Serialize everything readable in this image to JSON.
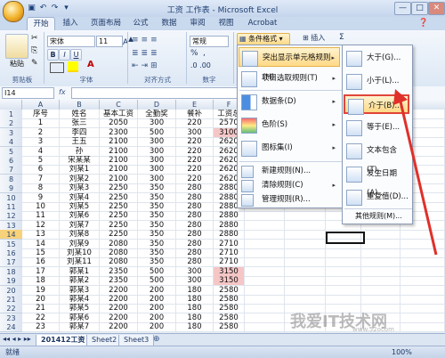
{
  "window": {
    "title": "工资 工作表 - Microsoft Excel",
    "controls": [
      "—",
      "□",
      "✕"
    ]
  },
  "tabs": [
    "开始",
    "插入",
    "页面布局",
    "公式",
    "数据",
    "审阅",
    "视图",
    "Acrobat"
  ],
  "ribbon": {
    "font_name": "宋体",
    "font_size": "11",
    "number_format": "常规",
    "cond_format_label": "条件格式",
    "insert_label": "插入",
    "sigma_label": "Σ",
    "groups": [
      "剪贴板",
      "字体",
      "对齐方式",
      "数字"
    ],
    "paste_label": "粘贴",
    "bold": "B",
    "italic": "I",
    "underline": "U",
    "percent": "%"
  },
  "formula_bar": {
    "name_box": "I14",
    "fx": "fx"
  },
  "columns": [
    "A",
    "B",
    "C",
    "D",
    "E",
    "F"
  ],
  "rows": [
    {
      "n": "1",
      "c": [
        "序号",
        "姓名",
        "基本工资",
        "全勤奖",
        "餐补",
        "工资总"
      ]
    },
    {
      "n": "2",
      "c": [
        "1",
        "张三",
        "2050",
        "300",
        "220",
        "2570"
      ]
    },
    {
      "n": "3",
      "c": [
        "2",
        "李四",
        "2300",
        "500",
        "300",
        "3100"
      ]
    },
    {
      "n": "4",
      "c": [
        "3",
        "王五",
        "2100",
        "300",
        "220",
        "2620"
      ]
    },
    {
      "n": "5",
      "c": [
        "4",
        "孙",
        "2100",
        "300",
        "220",
        "2620"
      ]
    },
    {
      "n": "6",
      "c": [
        "5",
        "宋某某",
        "2100",
        "300",
        "220",
        "2620"
      ]
    },
    {
      "n": "7",
      "c": [
        "6",
        "刘某1",
        "2100",
        "300",
        "220",
        "2620"
      ]
    },
    {
      "n": "8",
      "c": [
        "7",
        "刘某2",
        "2100",
        "300",
        "220",
        "2620"
      ]
    },
    {
      "n": "9",
      "c": [
        "8",
        "刘某3",
        "2250",
        "350",
        "280",
        "2880"
      ]
    },
    {
      "n": "10",
      "c": [
        "9",
        "刘某4",
        "2250",
        "350",
        "280",
        "2880"
      ]
    },
    {
      "n": "11",
      "c": [
        "10",
        "刘某5",
        "2250",
        "350",
        "280",
        "2880"
      ]
    },
    {
      "n": "12",
      "c": [
        "11",
        "刘某6",
        "2250",
        "350",
        "280",
        "2880"
      ]
    },
    {
      "n": "13",
      "c": [
        "12",
        "刘某7",
        "2250",
        "350",
        "280",
        "2880"
      ]
    },
    {
      "n": "14",
      "c": [
        "13",
        "刘某8",
        "2250",
        "350",
        "280",
        "2880"
      ]
    },
    {
      "n": "15",
      "c": [
        "14",
        "刘某9",
        "2080",
        "350",
        "280",
        "2710"
      ]
    },
    {
      "n": "16",
      "c": [
        "15",
        "刘某10",
        "2080",
        "350",
        "280",
        "2710"
      ]
    },
    {
      "n": "17",
      "c": [
        "16",
        "刘某11",
        "2080",
        "350",
        "280",
        "2710"
      ]
    },
    {
      "n": "18",
      "c": [
        "17",
        "郭某1",
        "2350",
        "500",
        "300",
        "3150"
      ]
    },
    {
      "n": "19",
      "c": [
        "18",
        "郭某2",
        "2350",
        "500",
        "300",
        "3150"
      ]
    },
    {
      "n": "20",
      "c": [
        "19",
        "郭某3",
        "2200",
        "200",
        "180",
        "2580"
      ]
    },
    {
      "n": "21",
      "c": [
        "20",
        "郭某4",
        "2200",
        "200",
        "180",
        "2580"
      ]
    },
    {
      "n": "22",
      "c": [
        "21",
        "郭某5",
        "2200",
        "200",
        "180",
        "2580"
      ]
    },
    {
      "n": "23",
      "c": [
        "22",
        "郭某6",
        "2200",
        "200",
        "180",
        "2580"
      ]
    },
    {
      "n": "24",
      "c": [
        "23",
        "郭某7",
        "2200",
        "200",
        "180",
        "2580"
      ]
    }
  ],
  "cond_menu": {
    "items": [
      {
        "label": "突出显示单元格规则(H)",
        "arrow": "▸"
      },
      {
        "label": "项目选取规则(T)",
        "arrow": "▸"
      },
      {
        "label": "数据条(D)",
        "arrow": "▸"
      },
      {
        "label": "色阶(S)",
        "arrow": "▸"
      },
      {
        "label": "图标集(I)",
        "arrow": "▸"
      }
    ],
    "extra": [
      "新建规则(N)...",
      "清除规则(C)",
      "管理规则(R)..."
    ]
  },
  "sub_menu": {
    "items": [
      "大于(G)...",
      "小于(L)...",
      "介于(B)...",
      "等于(E)...",
      "文本包含(T)...",
      "发生日期(A)...",
      "重复值(D)..."
    ],
    "more": "其他规则(M)..."
  },
  "sheets": [
    "201412工资",
    "Sheet2",
    "Sheet3"
  ],
  "status": {
    "left": "就绪",
    "zoom": "100%"
  },
  "watermark": {
    "text": "我爱IT技术网",
    "sub": "www.52ocom"
  }
}
